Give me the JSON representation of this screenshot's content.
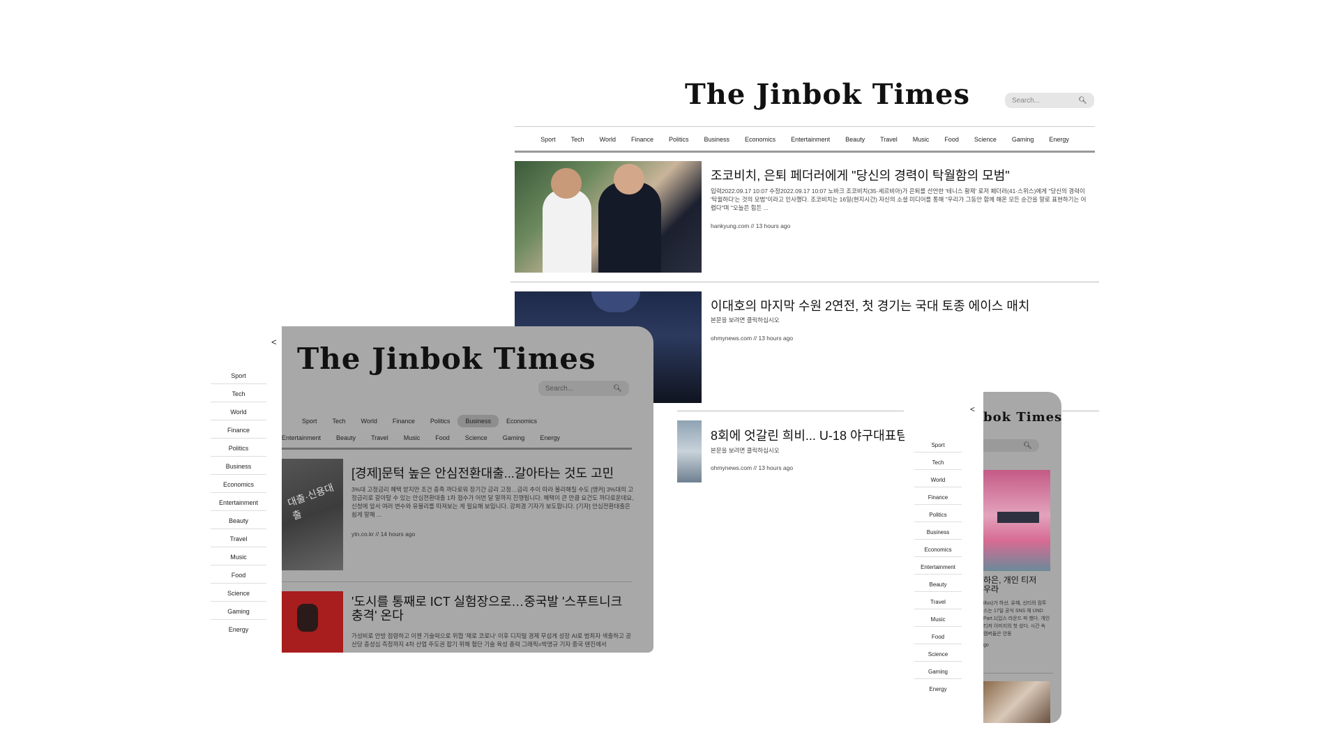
{
  "desktop": {
    "masthead": "The Jinbok Times",
    "search_placeholder": "Search...",
    "nav": [
      "Sport",
      "Tech",
      "World",
      "Finance",
      "Politics",
      "Business",
      "Economics",
      "Entertainment",
      "Beauty",
      "Travel",
      "Music",
      "Food",
      "Science",
      "Gaming",
      "Energy"
    ],
    "articles": [
      {
        "title": "조코비치, 은퇴 페더러에게 \"당신의 경력이 탁월함의 모범\"",
        "summary": "입력2022.09.17 10:07 수정2022.09.17 10:07 노바크 조코비치(35·세르비아)가 은퇴를 선언한 '테니스 황제' 로저 페더러(41·스위스)에게 \"당신의 경력이 '탁월하다'는 것의 모범\"이라고 인사했다. 조코비치는 16일(현지시간) 자신의 소셜 미디어를 통해 \"우리가 그동안 함께 해온 모든 순간을 말로 표현하기는 어렵다\"며 \"오늘은 힘든 ...",
        "meta": "hankyung.com // 13 hours ago"
      },
      {
        "title": "이대호의 마지막 수원 2연전, 첫 경기는 국대 토종 에이스 매치",
        "summary": "본문을 보려면 클릭하십시오",
        "meta": "ohmynews.com // 13 hours ago"
      },
      {
        "title": "8회에 엇갈린 희비... U-18 야구대표팀,",
        "summary": "본문을 보려면 클릭하십시오",
        "meta": "ohmynews.com // 13 hours ago"
      }
    ]
  },
  "sidebar": {
    "back": "<",
    "items": [
      "Sport",
      "Tech",
      "World",
      "Finance",
      "Politics",
      "Business",
      "Economics",
      "Entertainment",
      "Beauty",
      "Travel",
      "Music",
      "Food",
      "Science",
      "Gaming",
      "Energy"
    ]
  },
  "tablet": {
    "masthead": "The Jinbok Times",
    "search_placeholder": "Search...",
    "nav_row1": [
      "Sport",
      "Tech",
      "World",
      "Finance",
      "Politics",
      "Business",
      "Economics"
    ],
    "nav_row2": [
      "Entertainment",
      "Beauty",
      "Travel",
      "Music",
      "Food",
      "Science",
      "Gaming",
      "Energy"
    ],
    "active_nav": "Business",
    "articles": [
      {
        "title": "[경제]문턱 높은 안심전환대출...갈아타는 것도 고민",
        "summary": "3%대 고정금리 혜택 받지만 조건 충족 까다로워 장기간 금리 고정…금리 추이 따라 불리해질 수도 [앵커] 3%대의 고정금리로 갈아탈 수 있는 안심전환대출 1차 접수가 어번 달 말까지 진행됩니다. 혜택이 큰 만큼 요건도 까다로운데요, 신청에 앞서 여러 변수와 유불리를 따져보는 게 필요해 보입니다. 강희경 기자가 보도합니다. [기자] 안심전환대출은 쉽게 말해 ...",
        "meta": "ytn.co.kr // 14 hours ago"
      },
      {
        "title": "'도시를 통째로 ICT 실험장으로…중국발 '스푸트니크 충격' 온다",
        "summary": "가성비로 안방 점령하고 이젠 기술력으로 위협 '제로 코로나' 이후 디지털 경제 무섭게 성장 AI로 범죄자 색출하고 공산당 충성심 측정까지 4차 산업 주도권 잡기 위해 첨단 기술 육성 총력 그래픽=박명규 기자 중국 톈진에서",
        "meta": ""
      }
    ]
  },
  "phone_sidebar": {
    "back": "<",
    "items": [
      "Sport",
      "Tech",
      "World",
      "Finance",
      "Politics",
      "Business",
      "Economics",
      "Entertainment",
      "Beauty",
      "Travel",
      "Music",
      "Food",
      "Science",
      "Gaming",
      "Energy"
    ]
  },
  "phone": {
    "masthead_partial": "bok Times",
    "title_partial": "하은, 개인 티저 우라",
    "summary_partial": "illus)가 하선, 유혜, 신티의 컴투스는 17일 공식 SNS 채 UND Part.1(입스 라운드 파 했다. 개인 티저 이미지의 첫 성다. 시간 속 캠버들은 안동",
    "meta_partial": "go"
  }
}
